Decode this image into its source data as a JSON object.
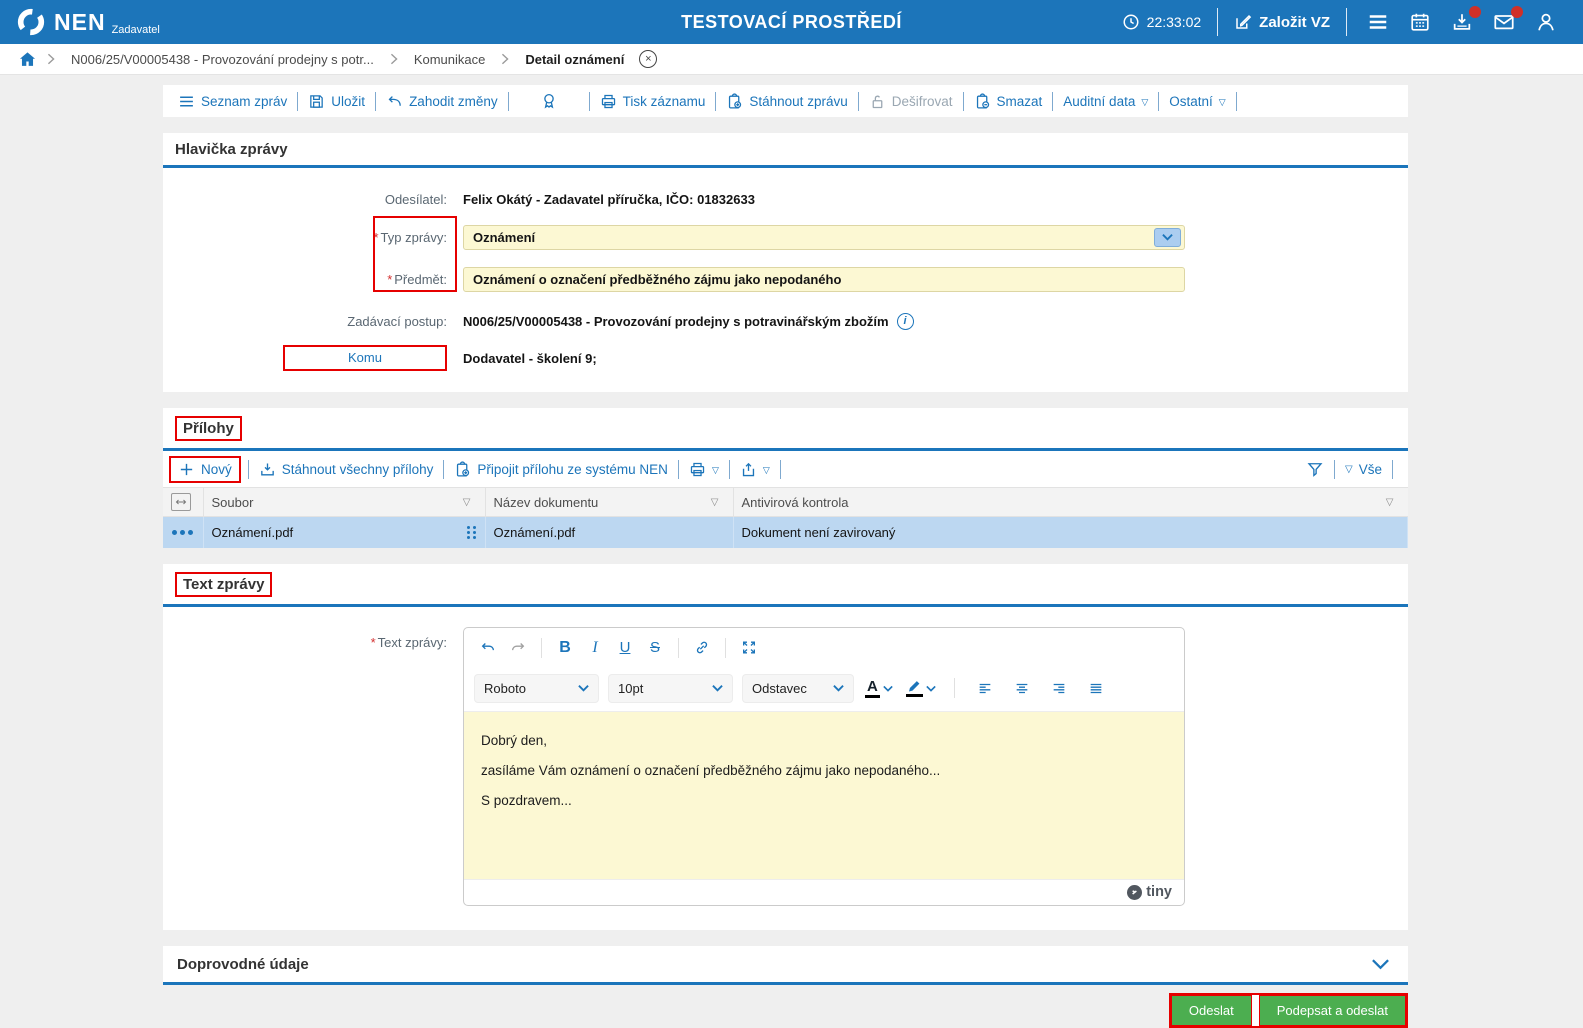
{
  "required_mark": "*",
  "header": {
    "logo_text": "NEN",
    "logo_sub": "Zadavatel",
    "env_title": "TESTOVACÍ PROSTŘEDÍ",
    "time": "22:33:02",
    "create_vz": "Založit VZ"
  },
  "breadcrumb": {
    "item_procedure": "N006/25/V00005438 - Provozování prodejny s potr...",
    "item_communication": "Komunikace",
    "item_detail": "Detail oznámení"
  },
  "toolbar": {
    "seznam_zprav": "Seznam zpráv",
    "ulozit": "Uložit",
    "zahodit_zmeny": "Zahodit změny",
    "tisk_zaznamu": "Tisk záznamu",
    "stahnout_zpravu": "Stáhnout zprávu",
    "desifrovat": "Dešifrovat",
    "smazat": "Smazat",
    "auditni_data": "Auditní data",
    "ostatni": "Ostatní"
  },
  "hlavicka": {
    "title": "Hlavička zprávy",
    "odesilatel_label": "Odesílatel:",
    "odesilatel_value": "Felix Okátý - Zadavatel příručka, IČO: 01832633",
    "typ_label": "Typ zprávy:",
    "typ_value": "Oznámení",
    "predmet_label": "Předmět:",
    "predmet_value": "Oznámení o označení předběžného zájmu jako nepodaného",
    "postup_label": "Zadávací postup:",
    "postup_value": "N006/25/V00005438 - Provozování prodejny s potravinářským zbožím",
    "komu_label": "Komu",
    "komu_value": "Dodavatel - školení 9;"
  },
  "prilohy": {
    "title": "Přílohy",
    "novy": "Nový",
    "stahnout_vse": "Stáhnout všechny přílohy",
    "pripojit": "Připojit přílohu ze systému NEN",
    "vse": "Vše",
    "col_soubor": "Soubor",
    "col_nazev": "Název dokumentu",
    "col_antivir": "Antivirová kontrola",
    "row_soubor": "Oznámení.pdf",
    "row_nazev": "Oznámení.pdf",
    "row_antivir": "Dokument není zavirovaný"
  },
  "text_zpravy": {
    "title": "Text zprávy",
    "label": "Text zprávy:",
    "font_name": "Roboto",
    "font_size": "10pt",
    "block_type": "Odstavec",
    "color_letter": "A",
    "para1": "Dobrý den,",
    "para2": "zasíláme Vám oznámení o označení předběžného zájmu jako nepodaného...",
    "para3": "S pozdravem...",
    "brand": "tiny"
  },
  "doprovodne": {
    "title": "Doprovodné údaje"
  },
  "actions": {
    "odeslat": "Odeslat",
    "podepsat": "Podepsat a odeslat"
  },
  "colors": {
    "header_blue": "#1c75ba",
    "accent_blue": "#1b75bb",
    "input_yellow": "#fcf8d3",
    "selected_row_blue": "#bcd7f1",
    "button_green": "#4cae50",
    "annotation_red": "#e60000",
    "badge_red": "#d03028"
  }
}
